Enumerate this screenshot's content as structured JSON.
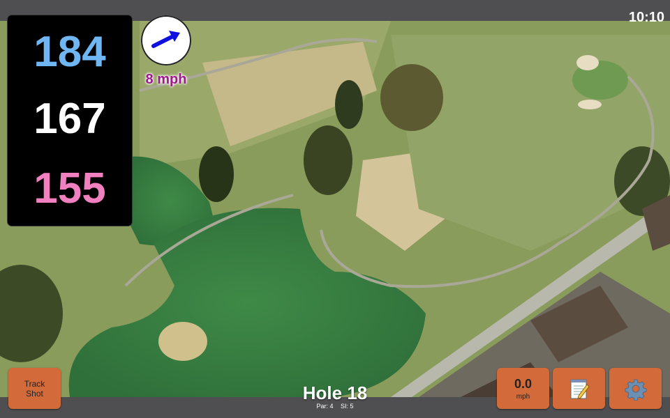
{
  "clock": "10:10",
  "distances": {
    "back": "184",
    "middle": "167",
    "front": "155"
  },
  "wind": {
    "speed_label": "8 mph",
    "direction_icon": "arrow-up-right"
  },
  "track_shot": {
    "label": "Track\nShot"
  },
  "speed": {
    "value": "0.0",
    "unit": "mph"
  },
  "notes": {
    "icon": "notepad"
  },
  "settings": {
    "icon": "gear"
  },
  "hole": {
    "label": "Hole 18",
    "par": "Par: 4",
    "si": "SI: 5"
  },
  "colors": {
    "back": "#6fb6f2",
    "middle": "#ffffff",
    "front": "#f080c0",
    "wind_text": "#a0198c",
    "button": "#d26a3a"
  }
}
